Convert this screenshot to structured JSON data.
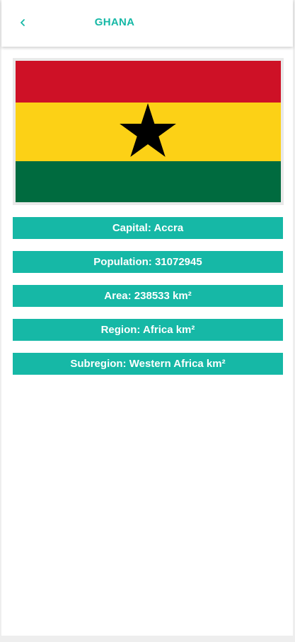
{
  "colors": {
    "accent": "#16b8a6",
    "flag_red": "#ce1126",
    "flag_yellow": "#fcd116",
    "flag_green": "#006b3f",
    "flag_star": "#000000"
  },
  "header": {
    "back_icon": "chevron-left-icon",
    "title": "GHANA"
  },
  "flag": {
    "country": "Ghana",
    "icon": "ghana-flag"
  },
  "details": {
    "capital": "Capital: Accra",
    "population": "Population: 31072945",
    "area": "Area: 238533 km²",
    "region": "Region: Africa km²",
    "subregion": "Subregion: Western Africa km²"
  }
}
